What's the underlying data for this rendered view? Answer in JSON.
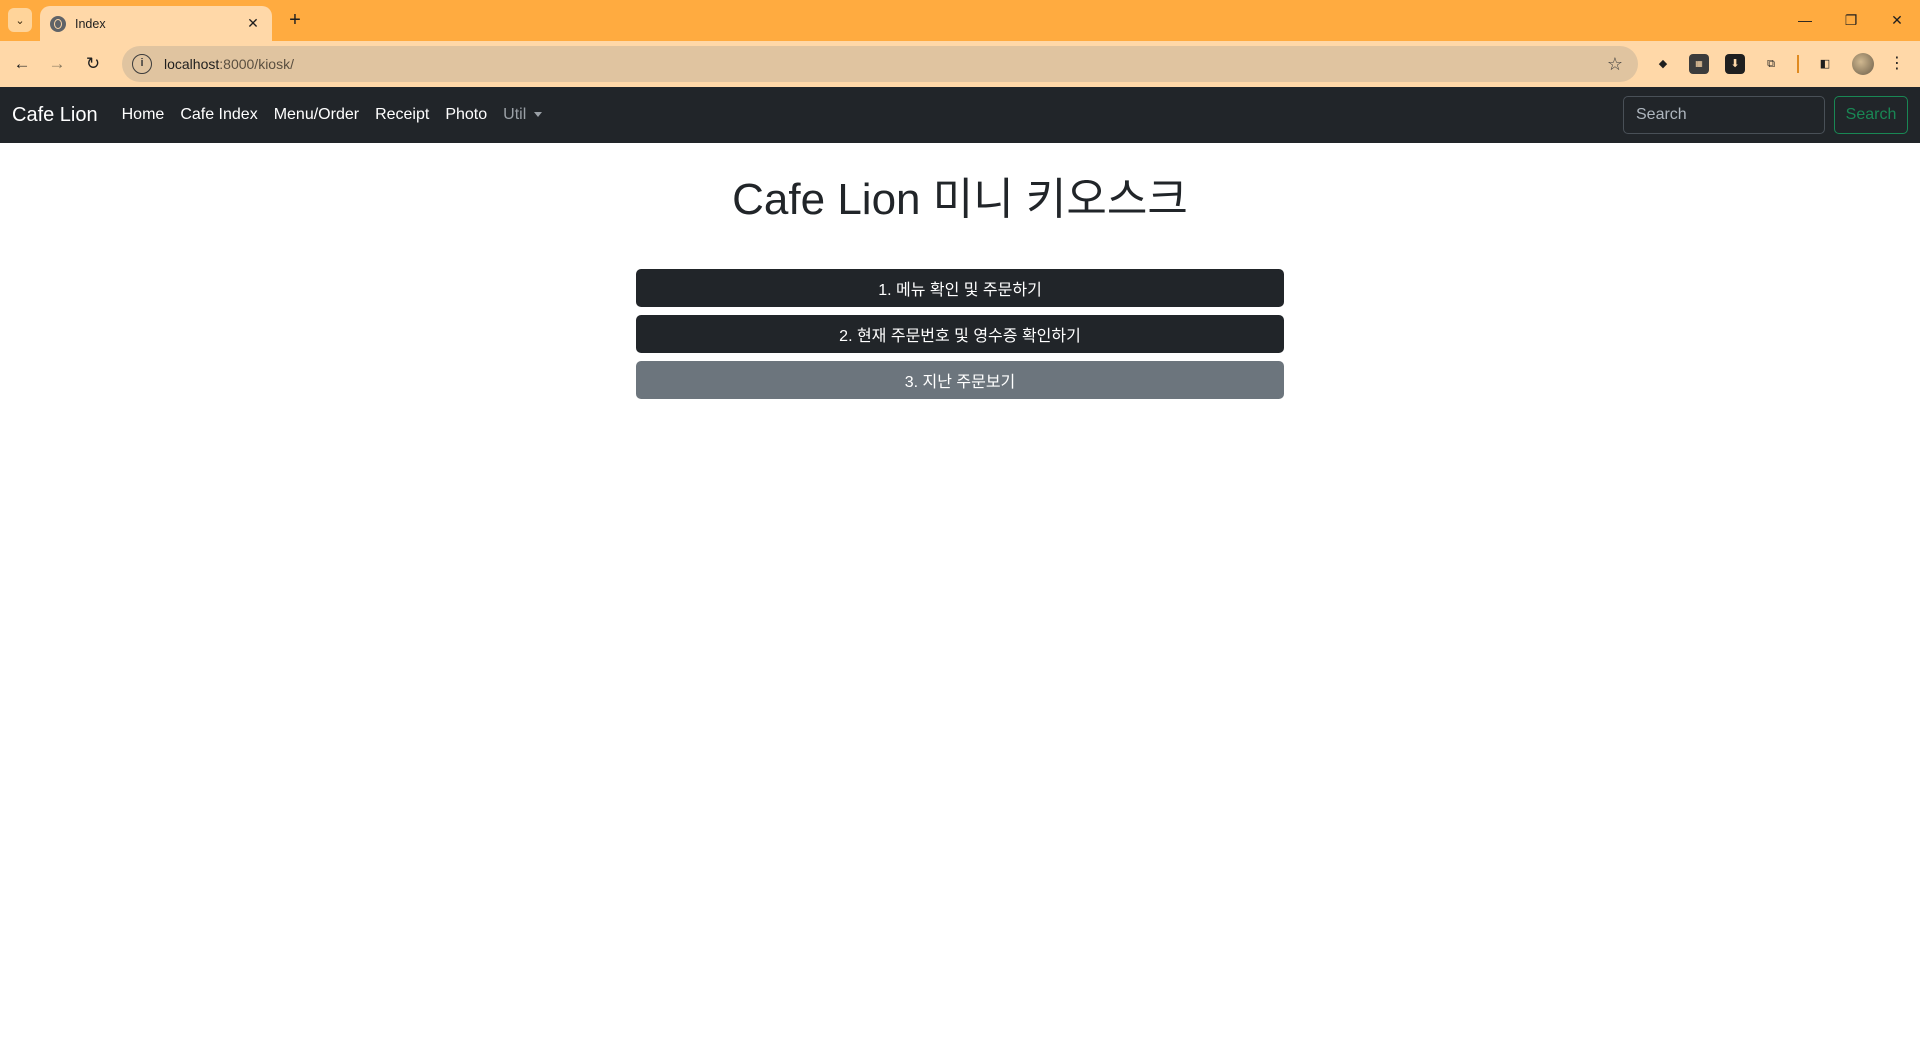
{
  "browser": {
    "tab_title": "Index",
    "tab_close": "✕",
    "new_tab": "+",
    "url_host": "localhost",
    "url_rest": ":8000/kiosk/",
    "window_controls": {
      "minimize": "—",
      "restore": "❐",
      "close": "✕"
    }
  },
  "navbar": {
    "brand": "Cafe Lion",
    "links": [
      "Home",
      "Cafe Index",
      "Menu/Order",
      "Receipt",
      "Photo"
    ],
    "util_label": "Util",
    "search_placeholder": "Search",
    "search_button": "Search"
  },
  "main": {
    "title": "Cafe Lion 미니 키오스크",
    "buttons": [
      {
        "label": "1. 메뉴 확인 및 주문하기"
      },
      {
        "label": "2. 현재 주문번호 및 영수증 확인하기"
      },
      {
        "label": "3. 지난 주문보기"
      }
    ]
  },
  "colors": {
    "tabstrip": "#ffab40",
    "toolbar": "#ffd8a8",
    "navbar": "#212529",
    "btn_dark": "#212529",
    "btn_secondary": "#6c757d",
    "success": "#198754"
  }
}
